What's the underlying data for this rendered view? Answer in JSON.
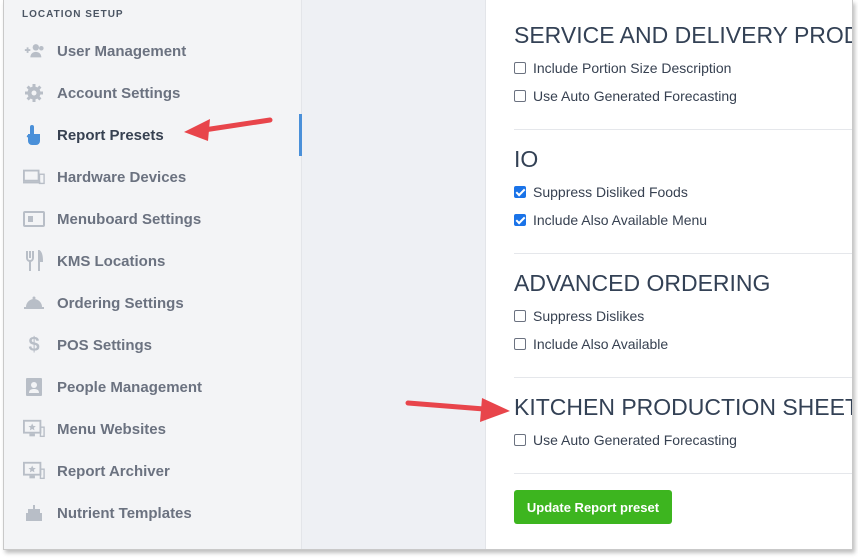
{
  "sidebar": {
    "title": "LOCATION SETUP",
    "items": [
      {
        "label": "User Management",
        "icon": "add-user-icon"
      },
      {
        "label": "Account Settings",
        "icon": "gear-icon"
      },
      {
        "label": "Report Presets",
        "icon": "pointer-hand-icon",
        "active": true
      },
      {
        "label": "Hardware Devices",
        "icon": "devices-icon"
      },
      {
        "label": "Menuboard Settings",
        "icon": "menuboard-icon"
      },
      {
        "label": "KMS Locations",
        "icon": "fork-knife-icon"
      },
      {
        "label": "Ordering Settings",
        "icon": "cloche-icon"
      },
      {
        "label": "POS Settings",
        "icon": "dollar-icon"
      },
      {
        "label": "People Management",
        "icon": "people-card-icon"
      },
      {
        "label": "Menu Websites",
        "icon": "monitor-star-icon"
      },
      {
        "label": "Report Archiver",
        "icon": "monitor-star-icon"
      },
      {
        "label": "Nutrient Templates",
        "icon": "cake-icon"
      }
    ]
  },
  "sections": [
    {
      "title": "SERVICE AND DELIVERY PRODUC",
      "options": [
        {
          "label": "Include Portion Size Description",
          "checked": false
        },
        {
          "label": "Use Auto Generated Forecasting",
          "checked": false
        }
      ]
    },
    {
      "title": "IO",
      "options": [
        {
          "label": "Suppress Disliked Foods",
          "checked": true
        },
        {
          "label": "Include Also Available Menu",
          "checked": true
        }
      ]
    },
    {
      "title": "ADVANCED ORDERING",
      "options": [
        {
          "label": "Suppress Dislikes",
          "checked": false
        },
        {
          "label": "Include Also Available",
          "checked": false
        }
      ]
    },
    {
      "title": "KITCHEN PRODUCTION SHEET",
      "options": [
        {
          "label": "Use Auto Generated Forecasting",
          "checked": false
        }
      ]
    }
  ],
  "update_button_label": "Update Report preset",
  "colors": {
    "accent": "#4a90d9",
    "checkbox_checked": "#1a73e8",
    "button": "#3db51f",
    "annotation_arrow": "#e8454b"
  }
}
